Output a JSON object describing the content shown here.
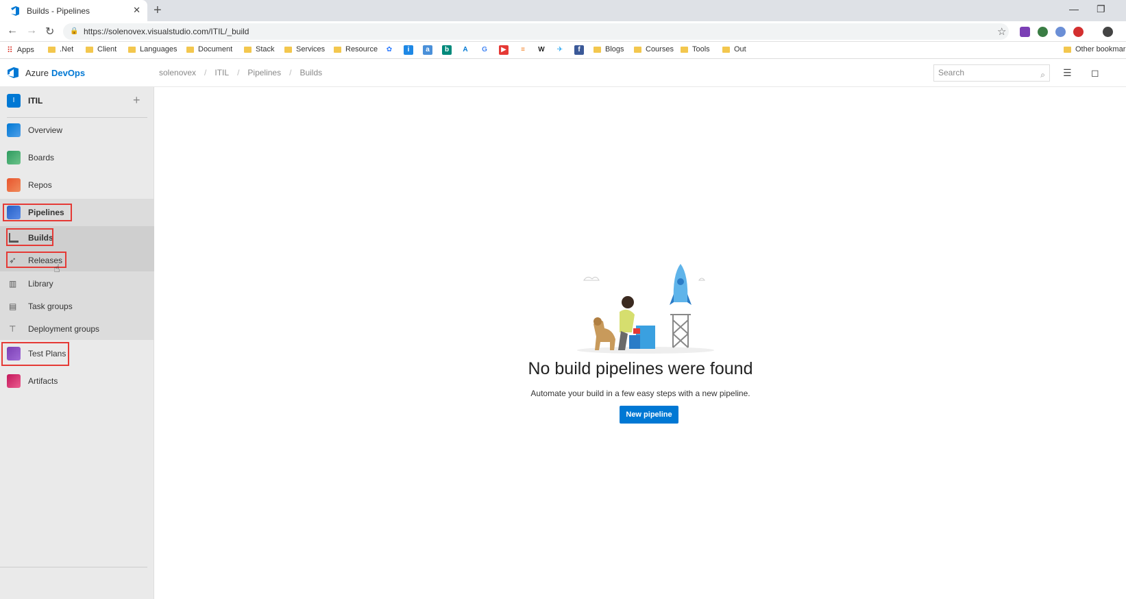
{
  "browser": {
    "tab_title": "Builds - Pipelines",
    "url": "https://solenovex.visualstudio.com/ITIL/_build",
    "bookmarks": {
      "apps": "Apps",
      "net": ".Net",
      "client": "Client",
      "languages": "Languages",
      "document": "Document",
      "stack": "Stack",
      "services": "Services",
      "resource": "Resource",
      "blogs": "Blogs",
      "courses": "Courses",
      "tools": "Tools",
      "out": "Out",
      "other": "Other bookmarks"
    }
  },
  "header": {
    "brand_prefix": "Azure",
    "brand_bold": "DevOps",
    "breadcrumb": [
      "solenovex",
      "ITIL",
      "Pipelines",
      "Builds"
    ],
    "search_placeholder": "Search"
  },
  "sidebar": {
    "project_initial": "I",
    "project_name": "ITIL",
    "items": {
      "overview": "Overview",
      "boards": "Boards",
      "repos": "Repos",
      "pipelines": "Pipelines",
      "builds": "Builds",
      "releases": "Releases",
      "library": "Library",
      "task_groups": "Task groups",
      "deployment_groups": "Deployment groups",
      "test_plans": "Test Plans",
      "artifacts": "Artifacts"
    }
  },
  "main": {
    "empty_title": "No build pipelines were found",
    "empty_subtitle": "Automate your build in a few easy steps with a new pipeline.",
    "new_pipeline_label": "New pipeline"
  },
  "colors": {
    "accent": "#0078d4",
    "highlight_box": "#e53935",
    "sidebar_bg": "#eaeaea"
  }
}
